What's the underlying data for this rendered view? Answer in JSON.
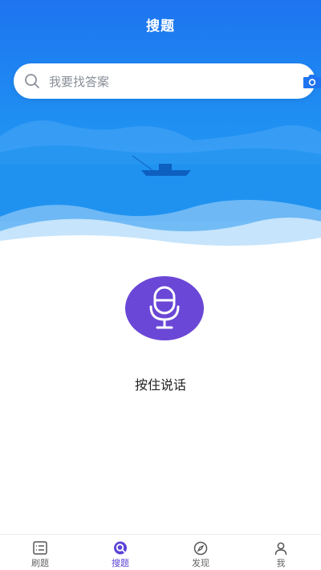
{
  "header": {
    "title": "搜题"
  },
  "search": {
    "placeholder": "我要找答案"
  },
  "voice": {
    "hint": "按住说话"
  },
  "tabs": [
    {
      "label": "刷题",
      "icon": "list-icon",
      "active": false
    },
    {
      "label": "搜题",
      "icon": "search-bubble-icon",
      "active": true
    },
    {
      "label": "发现",
      "icon": "compass-icon",
      "active": false
    },
    {
      "label": "我",
      "icon": "person-icon",
      "active": false
    }
  ],
  "colors": {
    "accent": "#6a47d6",
    "hero_blue": "#1e74f0"
  }
}
